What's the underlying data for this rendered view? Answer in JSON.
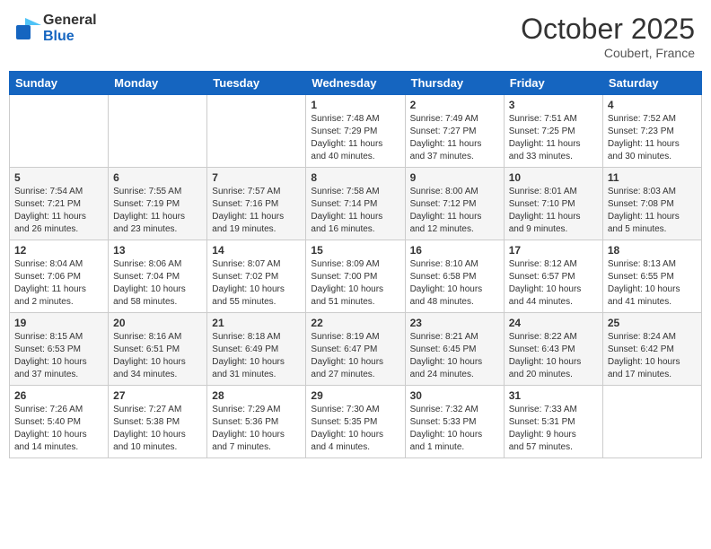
{
  "header": {
    "logo_line1": "General",
    "logo_line2": "Blue",
    "month": "October 2025",
    "location": "Coubert, France"
  },
  "weekdays": [
    "Sunday",
    "Monday",
    "Tuesday",
    "Wednesday",
    "Thursday",
    "Friday",
    "Saturday"
  ],
  "weeks": [
    [
      {
        "day": "",
        "info": ""
      },
      {
        "day": "",
        "info": ""
      },
      {
        "day": "",
        "info": ""
      },
      {
        "day": "1",
        "info": "Sunrise: 7:48 AM\nSunset: 7:29 PM\nDaylight: 11 hours\nand 40 minutes."
      },
      {
        "day": "2",
        "info": "Sunrise: 7:49 AM\nSunset: 7:27 PM\nDaylight: 11 hours\nand 37 minutes."
      },
      {
        "day": "3",
        "info": "Sunrise: 7:51 AM\nSunset: 7:25 PM\nDaylight: 11 hours\nand 33 minutes."
      },
      {
        "day": "4",
        "info": "Sunrise: 7:52 AM\nSunset: 7:23 PM\nDaylight: 11 hours\nand 30 minutes."
      }
    ],
    [
      {
        "day": "5",
        "info": "Sunrise: 7:54 AM\nSunset: 7:21 PM\nDaylight: 11 hours\nand 26 minutes."
      },
      {
        "day": "6",
        "info": "Sunrise: 7:55 AM\nSunset: 7:19 PM\nDaylight: 11 hours\nand 23 minutes."
      },
      {
        "day": "7",
        "info": "Sunrise: 7:57 AM\nSunset: 7:16 PM\nDaylight: 11 hours\nand 19 minutes."
      },
      {
        "day": "8",
        "info": "Sunrise: 7:58 AM\nSunset: 7:14 PM\nDaylight: 11 hours\nand 16 minutes."
      },
      {
        "day": "9",
        "info": "Sunrise: 8:00 AM\nSunset: 7:12 PM\nDaylight: 11 hours\nand 12 minutes."
      },
      {
        "day": "10",
        "info": "Sunrise: 8:01 AM\nSunset: 7:10 PM\nDaylight: 11 hours\nand 9 minutes."
      },
      {
        "day": "11",
        "info": "Sunrise: 8:03 AM\nSunset: 7:08 PM\nDaylight: 11 hours\nand 5 minutes."
      }
    ],
    [
      {
        "day": "12",
        "info": "Sunrise: 8:04 AM\nSunset: 7:06 PM\nDaylight: 11 hours\nand 2 minutes."
      },
      {
        "day": "13",
        "info": "Sunrise: 8:06 AM\nSunset: 7:04 PM\nDaylight: 10 hours\nand 58 minutes."
      },
      {
        "day": "14",
        "info": "Sunrise: 8:07 AM\nSunset: 7:02 PM\nDaylight: 10 hours\nand 55 minutes."
      },
      {
        "day": "15",
        "info": "Sunrise: 8:09 AM\nSunset: 7:00 PM\nDaylight: 10 hours\nand 51 minutes."
      },
      {
        "day": "16",
        "info": "Sunrise: 8:10 AM\nSunset: 6:58 PM\nDaylight: 10 hours\nand 48 minutes."
      },
      {
        "day": "17",
        "info": "Sunrise: 8:12 AM\nSunset: 6:57 PM\nDaylight: 10 hours\nand 44 minutes."
      },
      {
        "day": "18",
        "info": "Sunrise: 8:13 AM\nSunset: 6:55 PM\nDaylight: 10 hours\nand 41 minutes."
      }
    ],
    [
      {
        "day": "19",
        "info": "Sunrise: 8:15 AM\nSunset: 6:53 PM\nDaylight: 10 hours\nand 37 minutes."
      },
      {
        "day": "20",
        "info": "Sunrise: 8:16 AM\nSunset: 6:51 PM\nDaylight: 10 hours\nand 34 minutes."
      },
      {
        "day": "21",
        "info": "Sunrise: 8:18 AM\nSunset: 6:49 PM\nDaylight: 10 hours\nand 31 minutes."
      },
      {
        "day": "22",
        "info": "Sunrise: 8:19 AM\nSunset: 6:47 PM\nDaylight: 10 hours\nand 27 minutes."
      },
      {
        "day": "23",
        "info": "Sunrise: 8:21 AM\nSunset: 6:45 PM\nDaylight: 10 hours\nand 24 minutes."
      },
      {
        "day": "24",
        "info": "Sunrise: 8:22 AM\nSunset: 6:43 PM\nDaylight: 10 hours\nand 20 minutes."
      },
      {
        "day": "25",
        "info": "Sunrise: 8:24 AM\nSunset: 6:42 PM\nDaylight: 10 hours\nand 17 minutes."
      }
    ],
    [
      {
        "day": "26",
        "info": "Sunrise: 7:26 AM\nSunset: 5:40 PM\nDaylight: 10 hours\nand 14 minutes."
      },
      {
        "day": "27",
        "info": "Sunrise: 7:27 AM\nSunset: 5:38 PM\nDaylight: 10 hours\nand 10 minutes."
      },
      {
        "day": "28",
        "info": "Sunrise: 7:29 AM\nSunset: 5:36 PM\nDaylight: 10 hours\nand 7 minutes."
      },
      {
        "day": "29",
        "info": "Sunrise: 7:30 AM\nSunset: 5:35 PM\nDaylight: 10 hours\nand 4 minutes."
      },
      {
        "day": "30",
        "info": "Sunrise: 7:32 AM\nSunset: 5:33 PM\nDaylight: 10 hours\nand 1 minute."
      },
      {
        "day": "31",
        "info": "Sunrise: 7:33 AM\nSunset: 5:31 PM\nDaylight: 9 hours\nand 57 minutes."
      },
      {
        "day": "",
        "info": ""
      }
    ]
  ]
}
